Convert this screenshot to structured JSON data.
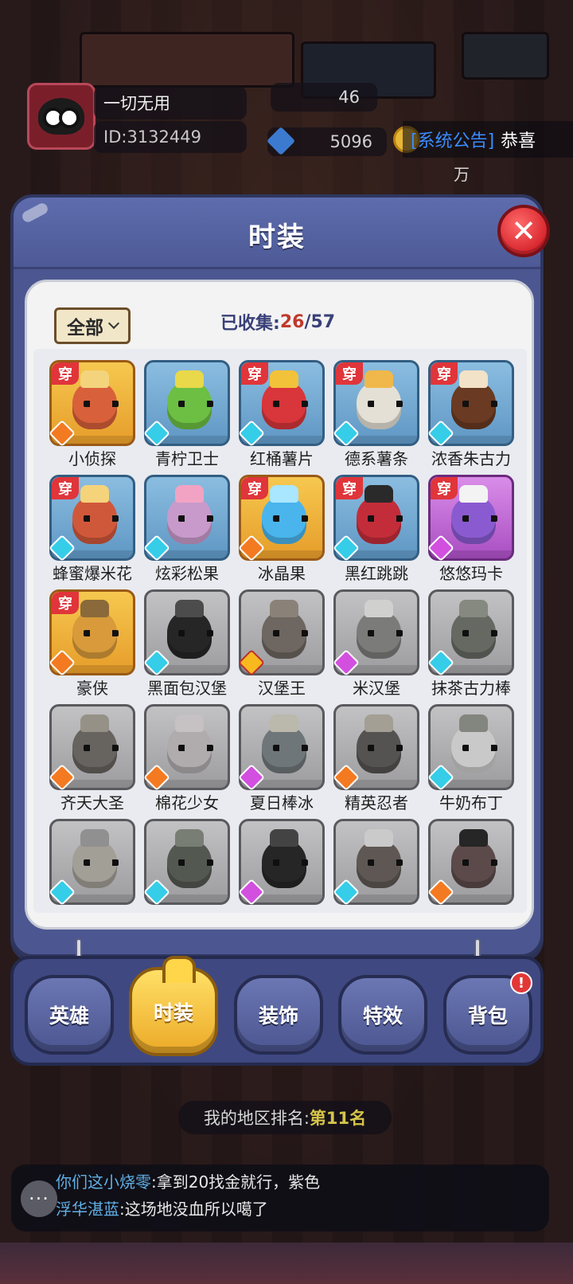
{
  "hud": {
    "player_name": "一切无用",
    "player_id": "ID:3132449",
    "level": "46",
    "gems": "5096",
    "announcement_tag": "[系统公告]",
    "announcement_text": "恭喜",
    "extra_text": "万"
  },
  "panel": {
    "title": "时装",
    "close_label": "✕",
    "filter_label": "全部",
    "collected_label": "已收集:",
    "collected_current": "26",
    "collected_separator": "/",
    "collected_total": "57",
    "wear_label": "穿"
  },
  "items": [
    {
      "name": "小侦探",
      "rarity": "orange",
      "gem": "orange",
      "worn": true,
      "c1": "#d8603a",
      "c2": "#f3d47c"
    },
    {
      "name": "青柠卫士",
      "rarity": "blue",
      "gem": "cyan",
      "worn": false,
      "c1": "#6cbf43",
      "c2": "#e8d84a"
    },
    {
      "name": "红桶薯片",
      "rarity": "blue",
      "gem": "cyan",
      "worn": true,
      "c1": "#d8363a",
      "c2": "#f2c23a"
    },
    {
      "name": "德系薯条",
      "rarity": "blue",
      "gem": "cyan",
      "worn": true,
      "c1": "#e4e0d6",
      "c2": "#f0b84a"
    },
    {
      "name": "浓香朱古力",
      "rarity": "blue",
      "gem": "cyan",
      "worn": true,
      "c1": "#6a3a22",
      "c2": "#f2e2c8"
    },
    {
      "name": "蜂蜜爆米花",
      "rarity": "blue",
      "gem": "cyan",
      "worn": true,
      "c1": "#d0583a",
      "c2": "#f5d37a"
    },
    {
      "name": "炫彩松果",
      "rarity": "blue",
      "gem": "cyan",
      "worn": false,
      "c1": "#c89acb",
      "c2": "#f2a3c3"
    },
    {
      "name": "冰晶果",
      "rarity": "orange",
      "gem": "orange",
      "worn": true,
      "c1": "#4ab5ec",
      "c2": "#a9e6ff"
    },
    {
      "name": "黑红跳跳",
      "rarity": "blue",
      "gem": "cyan",
      "worn": true,
      "c1": "#c32d3a",
      "c2": "#2a2a2a"
    },
    {
      "name": "悠悠玛卡",
      "rarity": "purple",
      "gem": "purple",
      "worn": true,
      "c1": "#8a5bd0",
      "c2": "#f3f3f3"
    },
    {
      "name": "豪侠",
      "rarity": "orange",
      "gem": "orange",
      "worn": true,
      "c1": "#d89a3a",
      "c2": "#8a6a3a"
    },
    {
      "name": "黑面包汉堡",
      "rarity": "gray",
      "gem": "cyan",
      "worn": false,
      "c1": "#2a2a2a",
      "c2": "#555555"
    },
    {
      "name": "汉堡王",
      "rarity": "gray",
      "gem": "gold",
      "worn": false,
      "c1": "#a46a3a",
      "c2": "#c48a4a"
    },
    {
      "name": "米汉堡",
      "rarity": "gray",
      "gem": "purple",
      "worn": false,
      "c1": "#8a8a7a",
      "c2": "#e8e8e0"
    },
    {
      "name": "抹茶古力棒",
      "rarity": "gray",
      "gem": "cyan",
      "worn": false,
      "c1": "#6a7a4a",
      "c2": "#8aa05a"
    },
    {
      "name": "齐天大圣",
      "rarity": "gray",
      "gem": "orange",
      "worn": false,
      "c1": "#8a6a4a",
      "c2": "#c0a050"
    },
    {
      "name": "棉花少女",
      "rarity": "gray",
      "gem": "orange",
      "worn": false,
      "c1": "#d8b8c8",
      "c2": "#f0d0e0"
    },
    {
      "name": "夏日棒冰",
      "rarity": "gray",
      "gem": "purple",
      "worn": false,
      "c1": "#5a8aa0",
      "c2": "#e0d070"
    },
    {
      "name": "精英忍者",
      "rarity": "gray",
      "gem": "orange",
      "worn": false,
      "c1": "#6a5a4a",
      "c2": "#d0b060"
    },
    {
      "name": "牛奶布丁",
      "rarity": "gray",
      "gem": "cyan",
      "worn": false,
      "c1": "#e0e0dc",
      "c2": "#8a9a6a"
    },
    {
      "name": "",
      "rarity": "gray",
      "gem": "cyan",
      "worn": false,
      "c1": "#c8b070",
      "c2": "#a0a0a0"
    },
    {
      "name": "",
      "rarity": "gray",
      "gem": "cyan",
      "worn": false,
      "c1": "#4a6a3a",
      "c2": "#6a9a4a"
    },
    {
      "name": "",
      "rarity": "gray",
      "gem": "purple",
      "worn": false,
      "c1": "#2a2a2a",
      "c2": "#4a4a4a"
    },
    {
      "name": "",
      "rarity": "gray",
      "gem": "cyan",
      "worn": false,
      "c1": "#8a5a3a",
      "c2": "#e0e0e0"
    },
    {
      "name": "",
      "rarity": "gray",
      "gem": "orange",
      "worn": false,
      "c1": "#c03a3a",
      "c2": "#2a2a2a"
    }
  ],
  "tabs": [
    {
      "label": "英雄",
      "active": false,
      "badge": ""
    },
    {
      "label": "时装",
      "active": true,
      "badge": ""
    },
    {
      "label": "装饰",
      "active": false,
      "badge": ""
    },
    {
      "label": "特效",
      "active": false,
      "badge": ""
    },
    {
      "label": "背包",
      "active": false,
      "badge": "!"
    }
  ],
  "rank": {
    "label": "我的地区排名:",
    "value": "第11名"
  },
  "chat": {
    "icon_text": "···",
    "messages": [
      {
        "user": "你们这小烧零",
        "text": ":拿到20找金就行，紫色"
      },
      {
        "user": "浮华湛蓝",
        "text": ":这场地没血所以噶了"
      }
    ]
  }
}
